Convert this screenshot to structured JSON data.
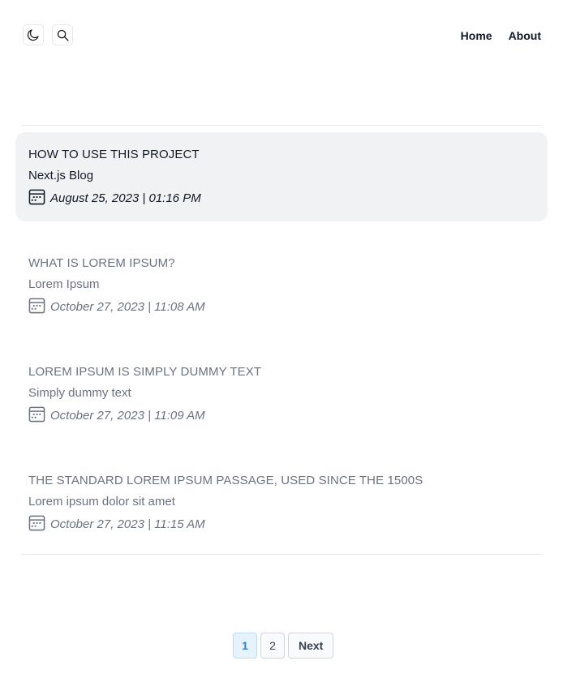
{
  "nav": {
    "links": [
      "Home",
      "About"
    ]
  },
  "icons": {
    "theme": "moon-icon",
    "search": "search-icon",
    "date": "calendar-icon"
  },
  "posts": [
    {
      "title": "HOW TO USE THIS PROJECT",
      "subtitle": "Next.js Blog",
      "date": "August 25, 2023 | 01:16 PM",
      "active": true
    },
    {
      "title": "WHAT IS LOREM IPSUM?",
      "subtitle": "Lorem Ipsum",
      "date": "October 27, 2023 | 11:08 AM",
      "active": false
    },
    {
      "title": "LOREM IPSUM IS SIMPLY DUMMY TEXT",
      "subtitle": "Simply dummy text",
      "date": "October 27, 2023 | 11:09 AM",
      "active": false
    },
    {
      "title": "THE STANDARD LOREM IPSUM PASSAGE, USED SINCE THE 1500S",
      "subtitle": "Lorem ipsum dolor sit amet",
      "date": "October 27, 2023 | 11:15 AM",
      "active": false
    }
  ],
  "pagination": {
    "pages": [
      "1",
      "2"
    ],
    "current": "1",
    "next_label": "Next"
  },
  "colors": {
    "active_bg": "#f1f2f4",
    "current_page": "#2f80c7"
  }
}
